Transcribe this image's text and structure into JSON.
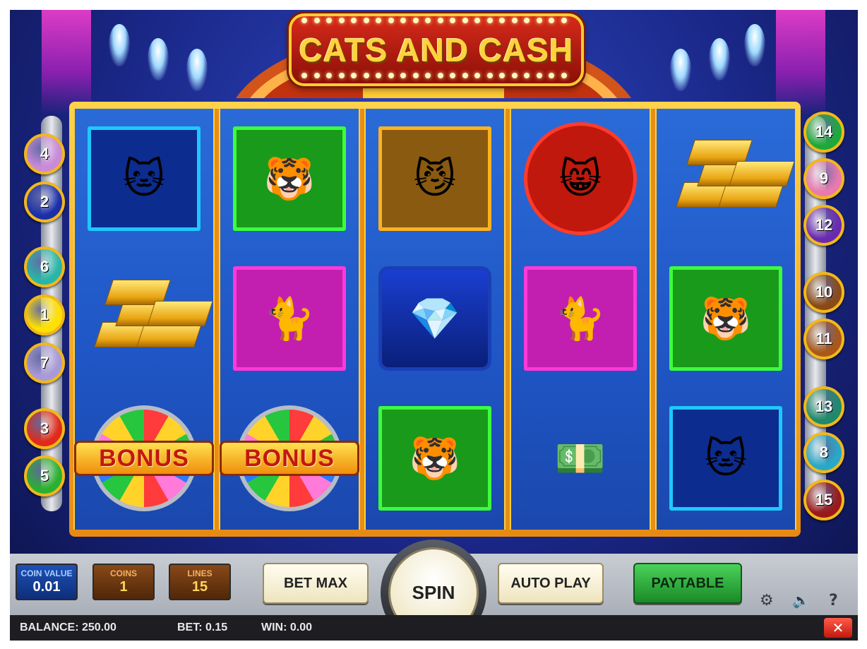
{
  "logo": {
    "text": "CATS AND CASH"
  },
  "reels": [
    [
      {
        "symbol": "red-dress-cat",
        "icon": "🐱",
        "frame": "#1ec8ff",
        "bg": "#0c2c8f"
      },
      {
        "symbol": "gold-bars",
        "icon": ""
      },
      {
        "symbol": "bonus",
        "label": "BONUS"
      }
    ],
    [
      {
        "symbol": "tabby-cat",
        "icon": "🐯",
        "frame": "#3cff3c",
        "bg": "#1a9a1a"
      },
      {
        "symbol": "persian-cat",
        "icon": "🐈",
        "frame": "#ff39d9",
        "bg": "#c21fb0"
      },
      {
        "symbol": "bonus",
        "label": "BONUS"
      }
    ],
    [
      {
        "symbol": "gangster-cat",
        "icon": "😼",
        "frame": "#ffb21e",
        "bg": "#8a5a10"
      },
      {
        "symbol": "diamond-necklace",
        "icon": "💎",
        "frame": "#1a3fb5",
        "bg": "#0d2a8a"
      },
      {
        "symbol": "tabby-cat",
        "icon": "🐯",
        "frame": "#3cff3c",
        "bg": "#1a9a1a"
      }
    ],
    [
      {
        "symbol": "singer-cat",
        "icon": "😸",
        "frame": "#ff3b2a",
        "bg": "#c0180c"
      },
      {
        "symbol": "persian-cat",
        "icon": "🐈",
        "frame": "#ff39d9",
        "bg": "#c21fb0"
      },
      {
        "symbol": "cash-stack",
        "icon": "💵",
        "frame": "",
        "bg": ""
      }
    ],
    [
      {
        "symbol": "gold-bars",
        "icon": ""
      },
      {
        "symbol": "tabby-cat",
        "icon": "🐯",
        "frame": "#3cff3c",
        "bg": "#1a9a1a"
      },
      {
        "symbol": "red-dress-cat",
        "icon": "🐱",
        "frame": "#1ec8ff",
        "bg": "#0c2c8f"
      }
    ]
  ],
  "lines_left": [
    {
      "num": "4",
      "color": "#c98ad8"
    },
    {
      "num": "2",
      "color": "#1a2fa8"
    },
    {
      "num": "6",
      "color": "#28b6a8"
    },
    {
      "num": "1",
      "color": "#ffe000"
    },
    {
      "num": "7",
      "color": "#a89ad8"
    },
    {
      "num": "3",
      "color": "#e02a1a"
    },
    {
      "num": "5",
      "color": "#2ab030"
    }
  ],
  "lines_right": [
    {
      "num": "14",
      "color": "#1fa83a"
    },
    {
      "num": "9",
      "color": "#e87ab0"
    },
    {
      "num": "12",
      "color": "#6a2ab0"
    },
    {
      "num": "10",
      "color": "#8a4a18"
    },
    {
      "num": "11",
      "color": "#a8581a"
    },
    {
      "num": "13",
      "color": "#1f8a6a"
    },
    {
      "num": "8",
      "color": "#2aa8c8"
    },
    {
      "num": "15",
      "color": "#9a1a1a"
    }
  ],
  "controls": {
    "coin_value_label": "COIN VALUE",
    "coin_value": "0.01",
    "coins_label": "COINS",
    "coins": "1",
    "lines_label": "LINES",
    "lines": "15",
    "bet_max": "BET MAX",
    "spin": "SPIN",
    "auto_play": "AUTO PLAY",
    "paytable": "PAYTABLE",
    "settings_icon": "⚙",
    "sound_icon": "🔊",
    "help_icon": "?"
  },
  "status": {
    "balance": "BALANCE: 250.00",
    "bet": "BET: 0.15",
    "win": "WIN: 0.00",
    "close_icon": "✕"
  }
}
